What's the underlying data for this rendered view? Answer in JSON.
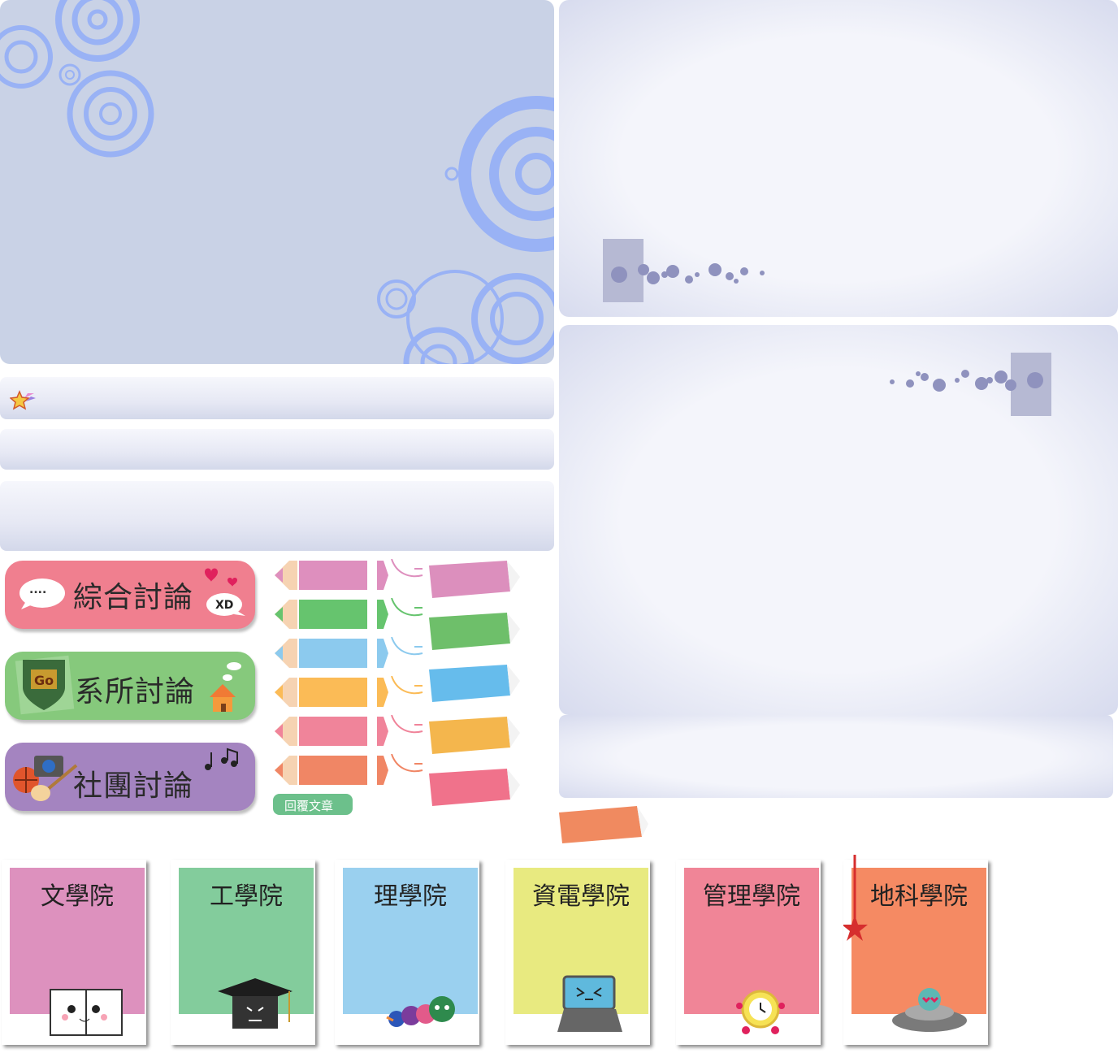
{
  "buttons": [
    {
      "label": "綜合討論",
      "badge": "XD",
      "dots": "....",
      "color": "#f07f8f"
    },
    {
      "label": "系所討論",
      "badge": "Go",
      "color": "#86c97c"
    },
    {
      "label": "社團討論",
      "color": "#a484c0"
    }
  ],
  "reply_button": {
    "label": "回覆文章",
    "color": "#6cc08b"
  },
  "pencil_colors": [
    "#de8fbe",
    "#66c46e",
    "#8ccaee",
    "#fbbb56",
    "#f0849a",
    "#f08665"
  ],
  "tape_colors": [
    "#dc8fbd",
    "#6ebf6a",
    "#66bcec",
    "#f4b64d",
    "#f0728b"
  ],
  "colleges": [
    {
      "name": "文學院",
      "color": "#dd91be",
      "mascot": "book-mascot-icon"
    },
    {
      "name": "工學院",
      "color": "#83cc9c",
      "mascot": "graduation-cap-mascot-icon"
    },
    {
      "name": "理學院",
      "color": "#9ad0ef",
      "mascot": "caterpillar-mascot-icon"
    },
    {
      "name": "資電學院",
      "color": "#e8ea80",
      "mascot": "laptop-mascot-icon"
    },
    {
      "name": "管理學院",
      "color": "#f08597",
      "mascot": "alarm-clock-mascot-icon"
    },
    {
      "name": "地科學院",
      "color": "#f58a63",
      "mascot": "alien-ufo-mascot-icon"
    }
  ],
  "colors": {
    "ring_panel": "#c9d2e6",
    "ring_stroke": "#99b2f5",
    "orange_tape": "#f08a60"
  }
}
